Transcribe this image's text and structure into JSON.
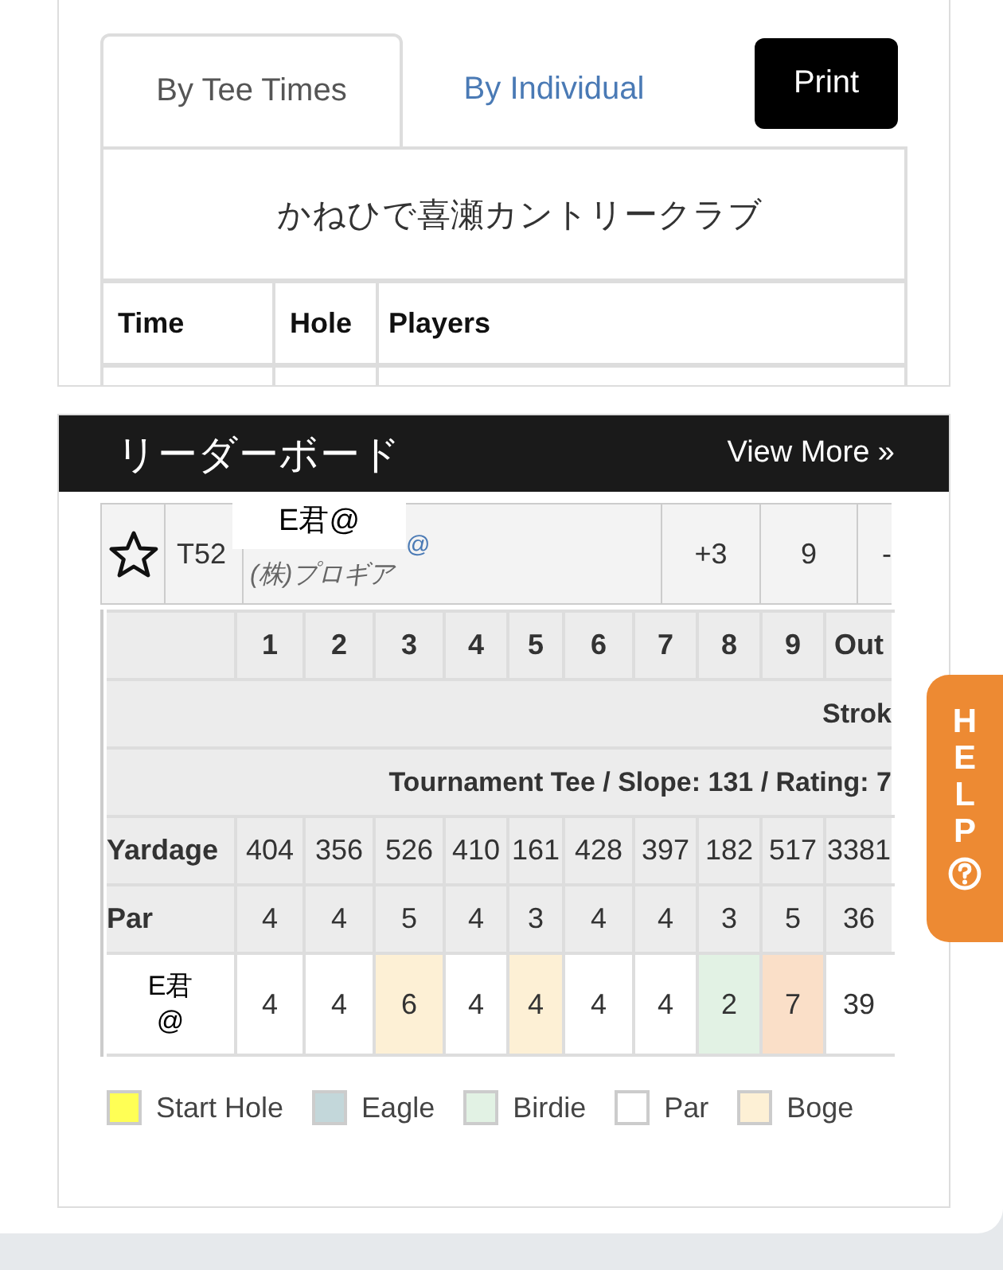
{
  "tabs": [
    {
      "label": "By Tee Times",
      "selected": true
    },
    {
      "label": "By Individual",
      "selected": false
    }
  ],
  "print_button": "Print",
  "course_name": "かねひで喜瀬カントリークラブ",
  "tee_table": {
    "columns": [
      "Time",
      "Hole",
      "Players"
    ]
  },
  "leaderboard": {
    "title": "リーダーボード",
    "view_more": "View More »",
    "row": {
      "favorite": false,
      "position": "T52",
      "player_link": "@",
      "company": "(株)プロギア",
      "score": "+3",
      "thru": "9",
      "column_6": "-"
    },
    "name_overlay": "E君@",
    "scorecard": {
      "holes": [
        "1",
        "2",
        "3",
        "4",
        "5",
        "6",
        "7",
        "8",
        "9",
        "Out"
      ],
      "stroke_label": "Strok",
      "tee_info": "Tournament Tee / Slope: 131 / Rating: 7",
      "yardage": {
        "label": "Yardage",
        "values": [
          "404",
          "356",
          "526",
          "410",
          "161",
          "428",
          "397",
          "182",
          "517",
          "3381"
        ]
      },
      "par": {
        "label": "Par",
        "values": [
          "4",
          "4",
          "5",
          "4",
          "3",
          "4",
          "4",
          "3",
          "5",
          "36"
        ]
      },
      "player": {
        "name": "E君@",
        "total": "39",
        "scores": [
          {
            "value": "4",
            "color": "#ffffff"
          },
          {
            "value": "4",
            "color": "#ffffff"
          },
          {
            "value": "6",
            "color": "#fdf0d5"
          },
          {
            "value": "4",
            "color": "#ffffff"
          },
          {
            "value": "4",
            "color": "#fdf0d5"
          },
          {
            "value": "4",
            "color": "#ffffff"
          },
          {
            "value": "4",
            "color": "#ffffff"
          },
          {
            "value": "2",
            "color": "#e2f2e4"
          },
          {
            "value": "7",
            "color": "#fadfc8"
          }
        ]
      }
    },
    "legend": [
      {
        "label": "Start Hole",
        "color": "#ffff55"
      },
      {
        "label": "Eagle",
        "color": "#c3d7da"
      },
      {
        "label": "Birdie",
        "color": "#e2f2e4"
      },
      {
        "label": "Par",
        "color": "#ffffff"
      },
      {
        "label": "Boge",
        "color": "#fdf0d5"
      }
    ]
  },
  "help": {
    "label": "HELP"
  }
}
